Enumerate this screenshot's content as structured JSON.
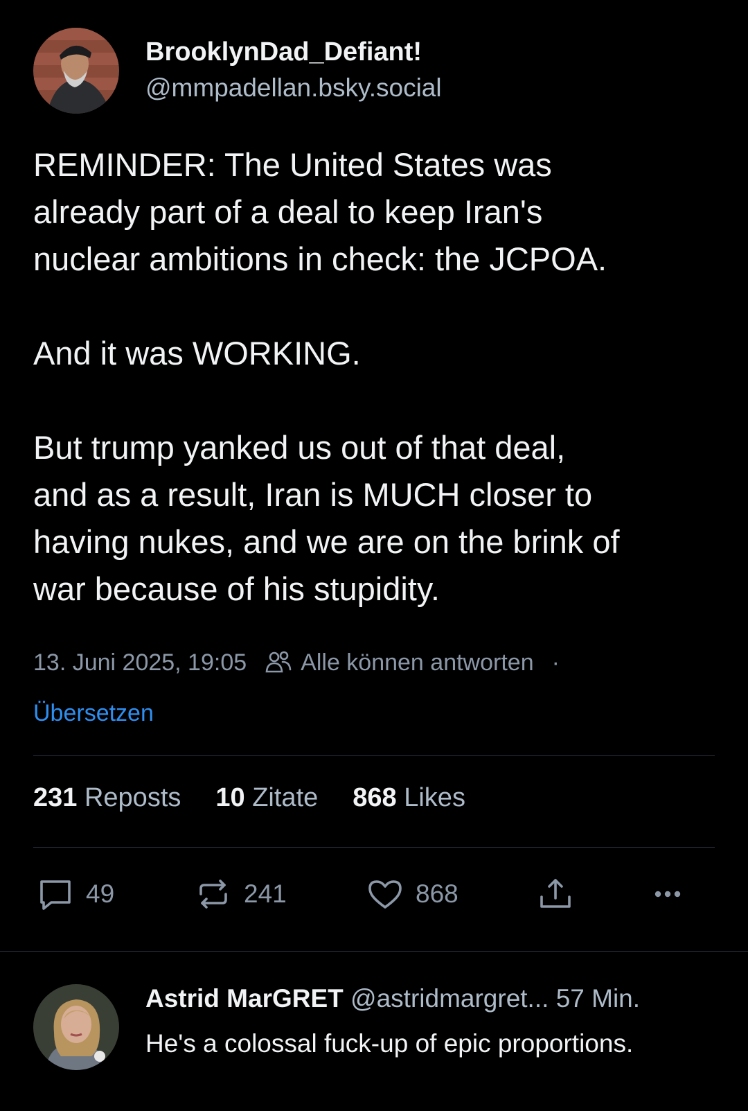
{
  "post": {
    "display_name": "BrooklynDad_Defiant!",
    "handle": "@mmpadellan.bsky.social",
    "text": "REMINDER: The United States was\nalready part of a deal to keep Iran's\nnuclear ambitions in check: the JCPOA.\n\nAnd it was WORKING.\n\nBut trump yanked us out of that deal,\nand as a result, Iran is MUCH closer to\nhaving nukes, and we are on the brink of\nwar because of his stupidity.",
    "timestamp": "13. Juni 2025, 19:05",
    "reply_permission": "Alle können antworten",
    "separator": "·",
    "translate_label": "Übersetzen"
  },
  "stats": {
    "reposts_count": "231",
    "reposts_label": "Reposts",
    "quotes_count": "10",
    "quotes_label": "Zitate",
    "likes_count": "868",
    "likes_label": "Likes"
  },
  "actions": {
    "reply_count": "49",
    "repost_count": "241",
    "like_count": "868",
    "icons": [
      "reply-icon",
      "repost-icon",
      "heart-icon",
      "share-icon",
      "more-icon"
    ]
  },
  "reply": {
    "display_name": "Astrid MarGRET",
    "handle": "@astridmargret...",
    "time": "57 Min.",
    "text": "He's a colossal fuck-up of epic proportions."
  },
  "colors": {
    "background": "#000000",
    "text": "#f1f3f5",
    "muted": "#8c98a8",
    "handle": "#aebbc9",
    "link": "#2f8ff0",
    "divider": "#2a3038"
  }
}
